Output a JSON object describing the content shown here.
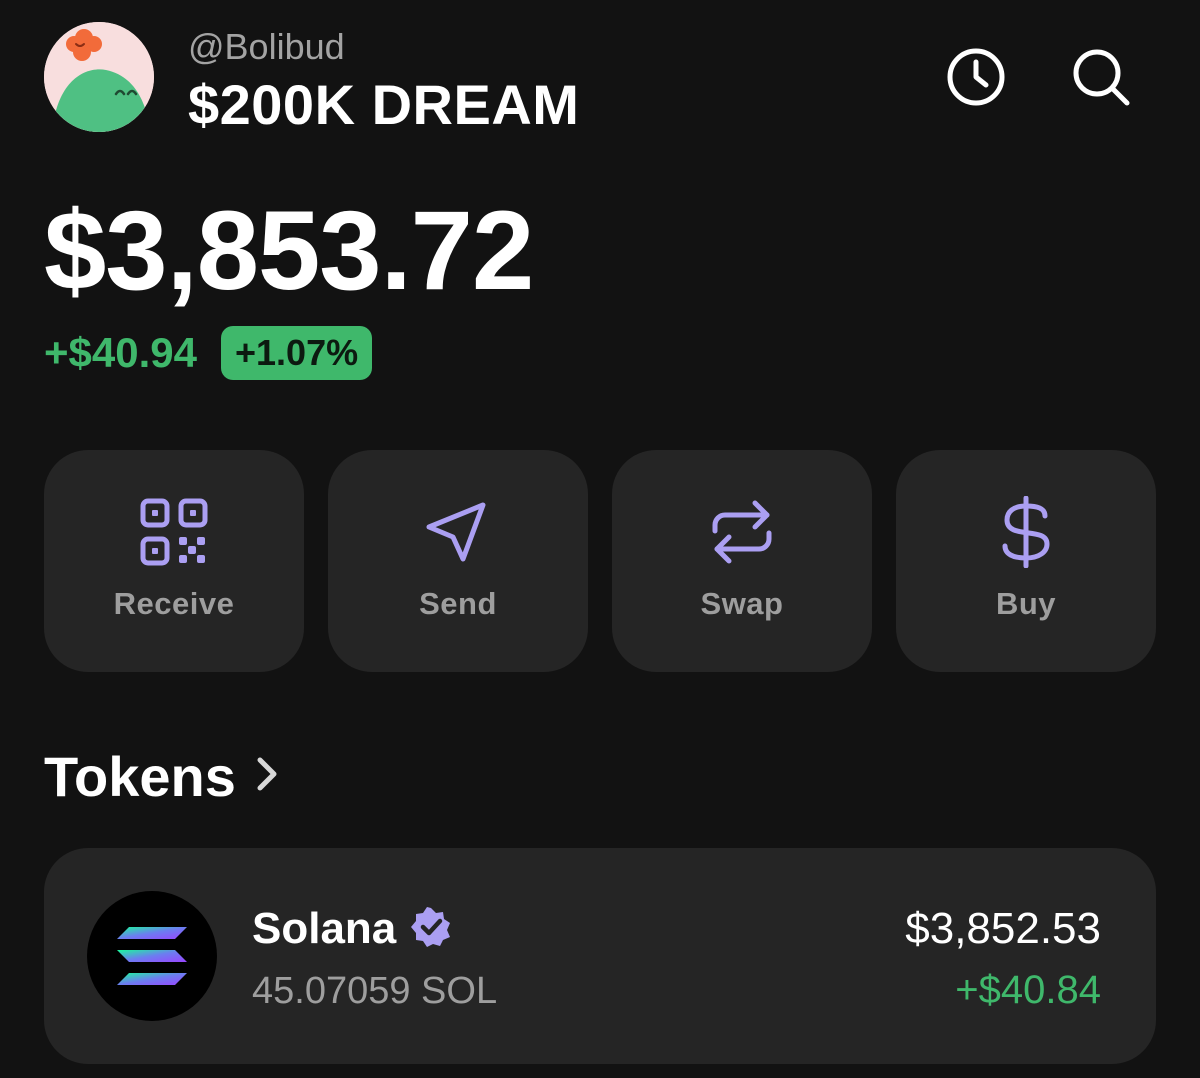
{
  "colors": {
    "accent": "#ab9ff2",
    "positive": "#3fb86b",
    "badge_bg": "#3fb86b",
    "card_bg": "#252525",
    "background": "#121212"
  },
  "header": {
    "avatar_icon": "avatar",
    "username": "@Bolibud",
    "account_name": "$200K DREAM",
    "history_icon": "clock-icon",
    "search_icon": "search-icon"
  },
  "portfolio": {
    "balance": "$3,853.72",
    "change_value": "+$40.94",
    "change_percent": "+1.07%"
  },
  "actions": [
    {
      "label": "Receive",
      "icon": "qr-code-icon"
    },
    {
      "label": "Send",
      "icon": "send-icon"
    },
    {
      "label": "Swap",
      "icon": "swap-icon"
    },
    {
      "label": "Buy",
      "icon": "dollar-icon"
    }
  ],
  "tokens": {
    "heading": "Tokens",
    "items": [
      {
        "name": "Solana",
        "verified": true,
        "amount": "45.07059 SOL",
        "value": "$3,852.53",
        "change": "+$40.84"
      }
    ]
  }
}
